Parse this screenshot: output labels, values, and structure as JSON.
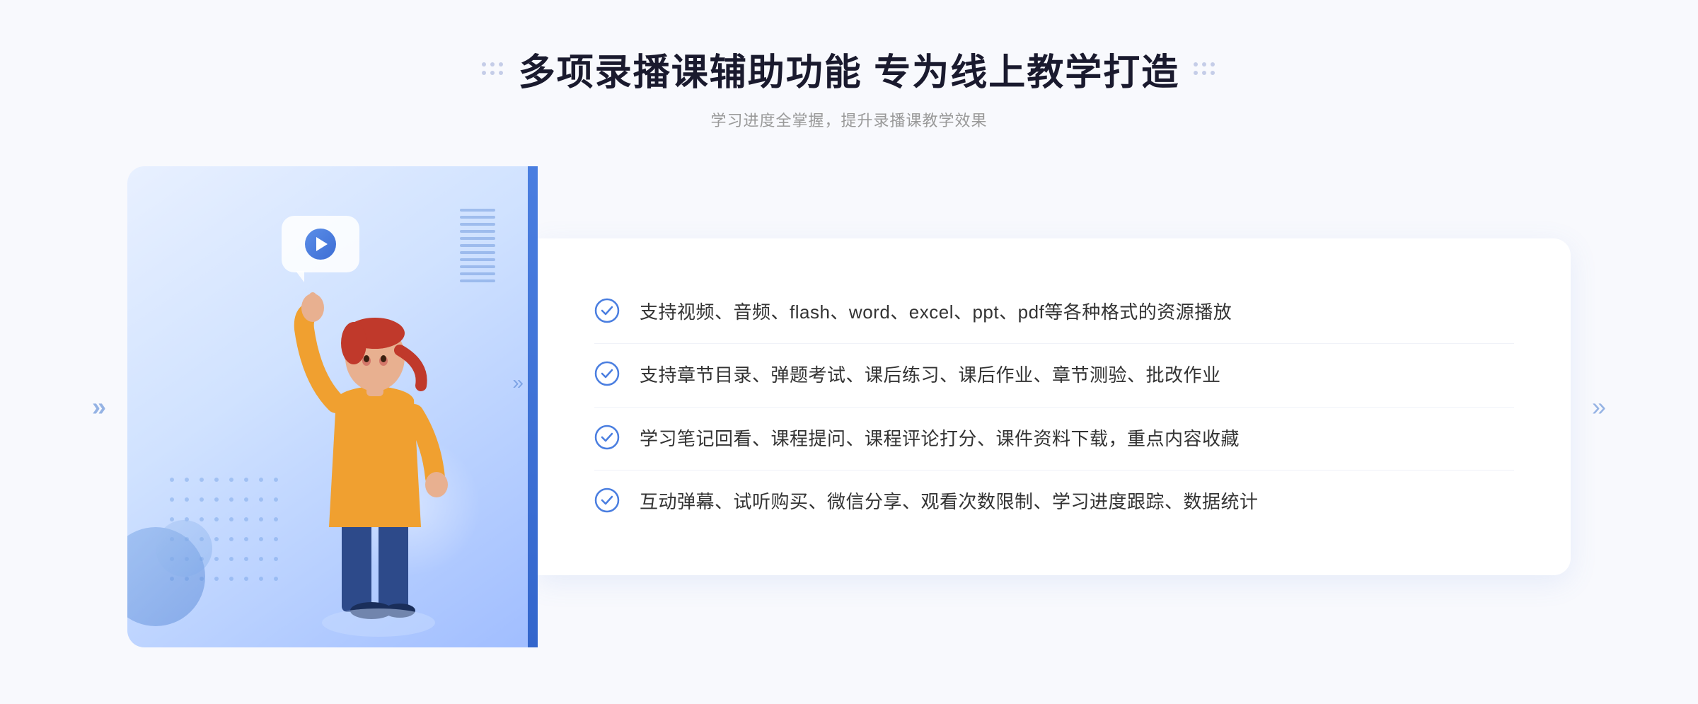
{
  "header": {
    "title": "多项录播课辅助功能 专为线上教学打造",
    "subtitle": "学习进度全掌握，提升录播课教学效果",
    "title_dots_left": "decorative-dots",
    "title_dots_right": "decorative-dots"
  },
  "features": [
    {
      "id": 1,
      "text": "支持视频、音频、flash、word、excel、ppt、pdf等各种格式的资源播放"
    },
    {
      "id": 2,
      "text": "支持章节目录、弹题考试、课后练习、课后作业、章节测验、批改作业"
    },
    {
      "id": 3,
      "text": "学习笔记回看、课程提问、课程评论打分、课件资料下载，重点内容收藏"
    },
    {
      "id": 4,
      "text": "互动弹幕、试听购买、微信分享、观看次数限制、学习进度跟踪、数据统计"
    }
  ],
  "colors": {
    "primary_blue": "#4a7ee0",
    "light_blue_bg": "#d6e5ff",
    "check_color": "#4a7ee0",
    "title_color": "#1a1a2e",
    "text_color": "#333333",
    "subtitle_color": "#999999"
  },
  "icons": {
    "check": "circle-check",
    "play": "play-button",
    "arrow_left": "«",
    "arrow_right": "»"
  }
}
